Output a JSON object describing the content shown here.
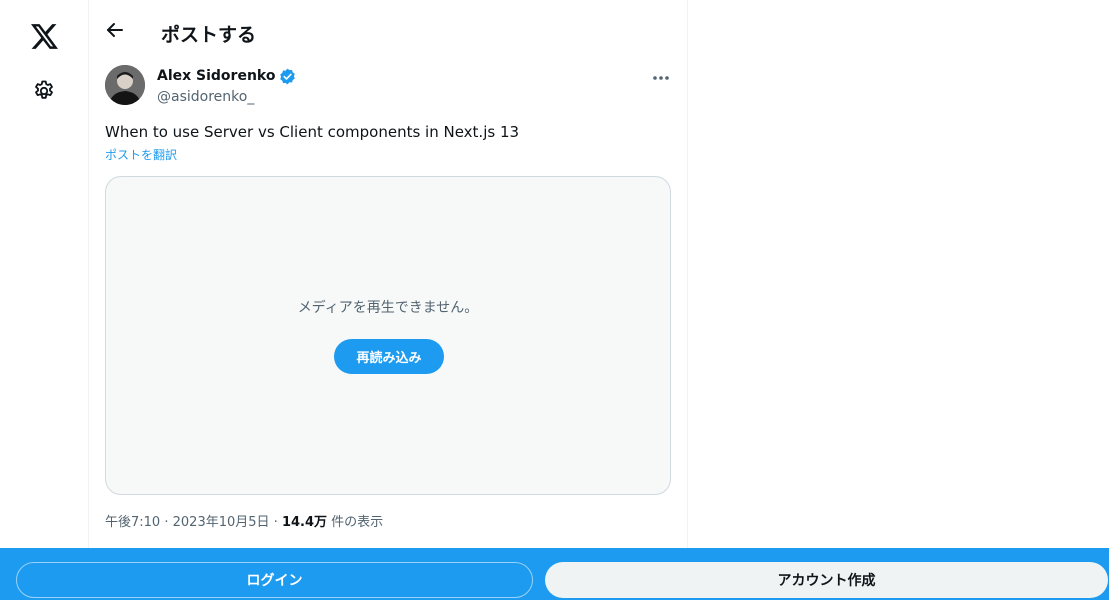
{
  "nav": {
    "logo_icon": "x-logo-icon",
    "settings_icon": "gear-icon"
  },
  "header": {
    "back_icon": "arrow-left-icon",
    "title": "ポストする"
  },
  "post": {
    "author_name": "Alex Sidorenko",
    "verified_icon": "verified-badge-icon",
    "author_handle": "@asidorenko_",
    "more_icon": "more-horizontal-icon",
    "text": "When to use Server vs Client components in Next.js 13",
    "translate_label": "ポストを翻訳",
    "media": {
      "error_text": "メディアを再生できません。",
      "reload_label": "再読み込み"
    },
    "meta": {
      "time": "午後7:10",
      "separator": "·",
      "date": "2023年10月5日",
      "views_count": "14.4万",
      "views_suffix": "件の表示"
    }
  },
  "bottom_bar": {
    "login_label": "ログイン",
    "signup_label": "アカウント作成"
  },
  "colors": {
    "accent": "#1d9bf0",
    "text_primary": "#0f1419",
    "text_secondary": "#536471",
    "border": "#cfd9de",
    "media_bg": "#f7f9f9"
  }
}
